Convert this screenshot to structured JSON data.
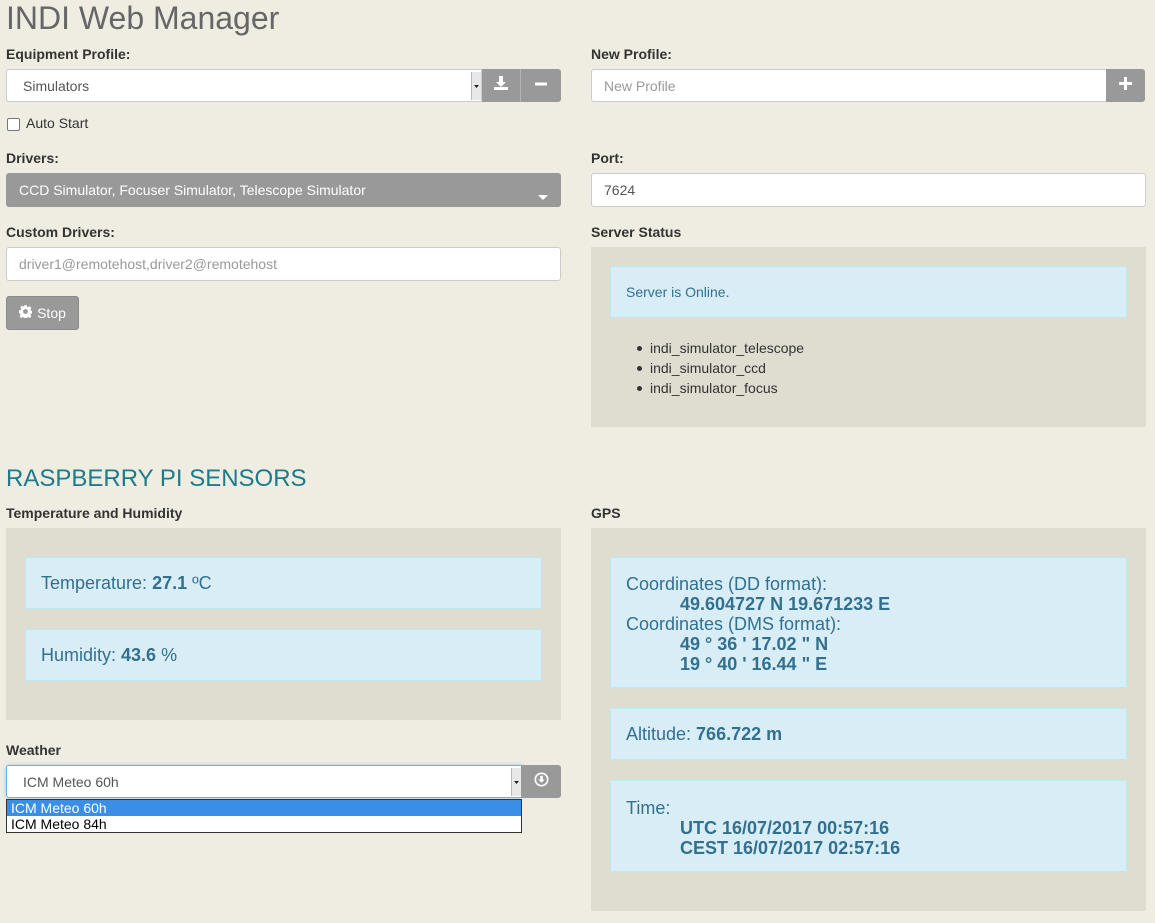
{
  "app": {
    "title": "INDI Web Manager"
  },
  "profile": {
    "label": "Equipment Profile:",
    "selected": "Simulators",
    "save_icon": "download-icon",
    "remove_icon": "minus-icon"
  },
  "new_profile": {
    "label": "New Profile:",
    "placeholder": "New Profile",
    "add_icon": "plus-icon"
  },
  "autostart": {
    "label": "Auto Start",
    "checked": false
  },
  "drivers": {
    "label": "Drivers:",
    "selected": "CCD Simulator, Focuser Simulator, Telescope Simulator"
  },
  "port": {
    "label": "Port:",
    "value": "7624"
  },
  "custom_drivers": {
    "label": "Custom Drivers:",
    "placeholder": "driver1@remotehost,driver2@remotehost"
  },
  "server_button": {
    "icon": "gear-icon",
    "label": "Stop"
  },
  "server_status": {
    "label": "Server Status",
    "message": "Server is Online.",
    "drivers": [
      "indi_simulator_telescope",
      "indi_simulator_ccd",
      "indi_simulator_focus"
    ]
  },
  "sensors": {
    "title": "RASPBERRY PI SENSORS",
    "temp_humidity_label": "Temperature and Humidity",
    "temperature": {
      "prefix": "Temperature: ",
      "value": "27.1",
      "unit": " ºC"
    },
    "humidity": {
      "prefix": "Humidity: ",
      "value": "43.6",
      "unit": " %"
    }
  },
  "gps": {
    "label": "GPS",
    "dd_label": "Coordinates (DD format):",
    "dd_value": "49.604727 N 19.671233 E",
    "dms_label": "Coordinates (DMS format):",
    "dms_lat": "49 ° 36 ' 17.02 \" N",
    "dms_lon": "19 ° 40 ' 16.44 \" E",
    "altitude_prefix": "Altitude: ",
    "altitude_value": "766.722 m",
    "time_label": "Time:",
    "utc": "UTC 16/07/2017 00:57:16",
    "cest": "CEST 16/07/2017 02:57:16"
  },
  "weather": {
    "label": "Weather",
    "selected": "ICM Meteo 60h",
    "options": [
      "ICM Meteo 60h",
      "ICM Meteo 84h"
    ],
    "download_icon": "download-circle-icon"
  },
  "colors": {
    "background": "#efede2",
    "panel": "#dfdcd0",
    "alert_bg": "#d9edf7",
    "alert_text": "#31708f",
    "section_title": "#1d7b8c",
    "button_gray": "#999999",
    "dropdown_highlight": "#3b8ee6"
  }
}
